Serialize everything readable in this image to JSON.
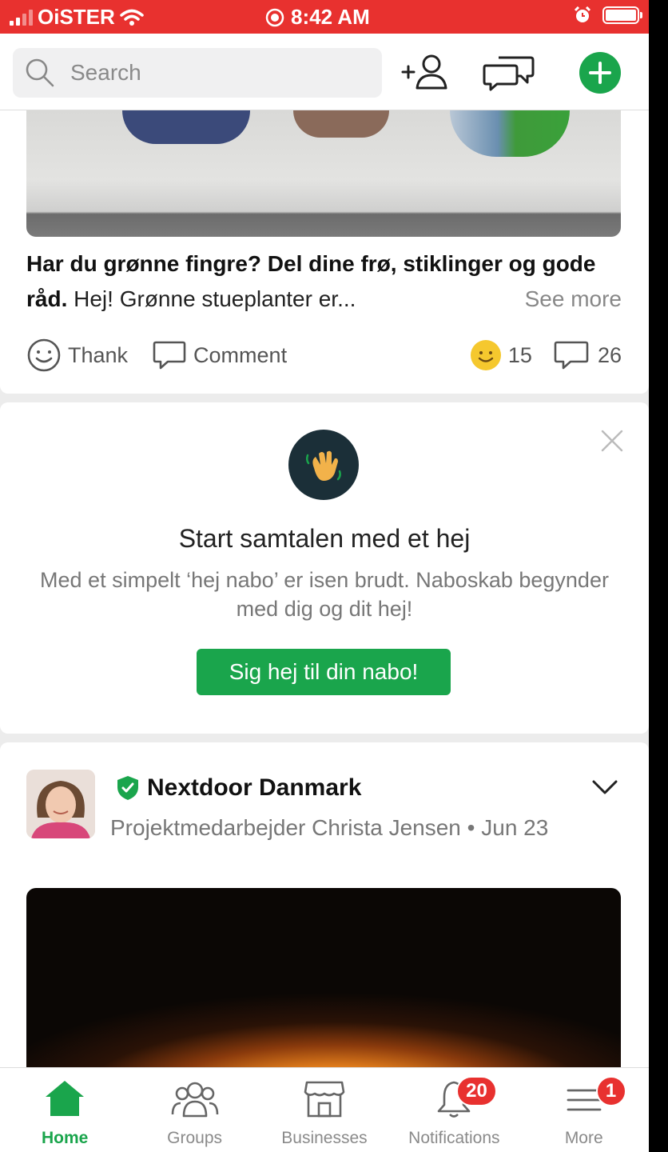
{
  "status_bar": {
    "carrier": "OiSTER",
    "time": "8:42 AM",
    "icons": [
      "signal-icon",
      "wifi-icon",
      "screen-record-icon",
      "alarm-icon",
      "battery-icon"
    ]
  },
  "header": {
    "search_placeholder": "Search",
    "icons": [
      "add-neighbor-icon",
      "messages-icon",
      "compose-plus-icon"
    ],
    "accent_color": "#1aa54c"
  },
  "post1": {
    "title": "Har du grønne fingre? Del dine frø, stiklinger og gode råd.",
    "body": "Hej!  Grønne stueplanter er...",
    "see_more": "See more",
    "thank_label": "Thank",
    "comment_label": "Comment",
    "reaction_count": "15",
    "comment_count": "26"
  },
  "hello_card": {
    "title": "Start samtalen med et hej",
    "body": "Med et simpelt ‘hej nabo’ er isen brudt. Naboskab begynder med dig og dit hej!",
    "button": "Sig hej til din nabo!"
  },
  "post2": {
    "author": "Nextdoor Danmark",
    "subline": "Projektmedarbejder Christa Jensen • Jun 23"
  },
  "bottom_nav": {
    "items": [
      {
        "label": "Home",
        "icon": "home-icon",
        "active": true
      },
      {
        "label": "Groups",
        "icon": "groups-icon"
      },
      {
        "label": "Businesses",
        "icon": "storefront-icon"
      },
      {
        "label": "Notifications",
        "icon": "bell-icon",
        "badge": "20"
      },
      {
        "label": "More",
        "icon": "menu-icon",
        "badge": "1"
      }
    ],
    "badge_color": "#e8312f"
  }
}
